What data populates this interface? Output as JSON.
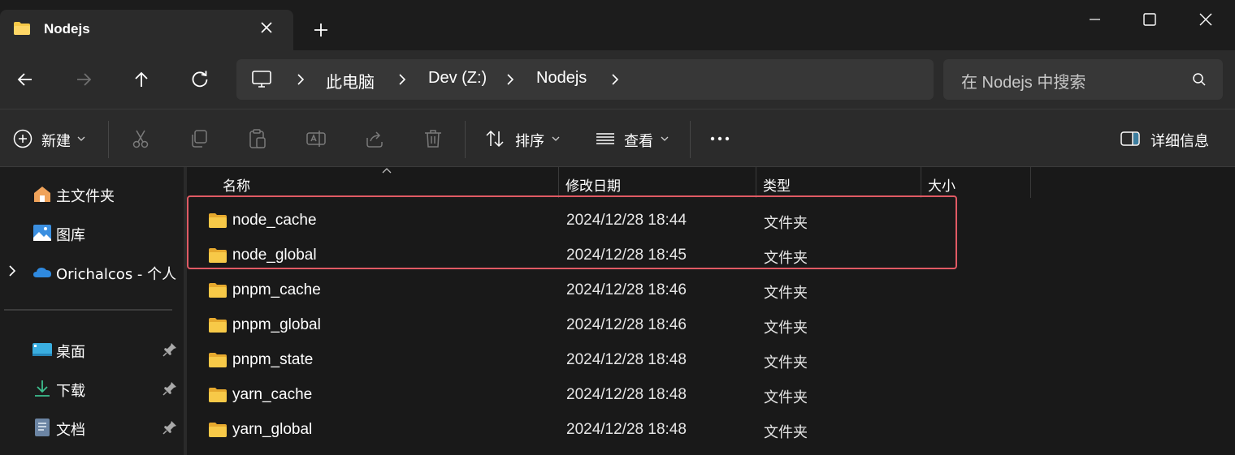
{
  "tab": {
    "title": "Nodejs"
  },
  "address": {
    "crumbs": [
      "此电脑",
      "Dev (Z:)",
      "Nodejs"
    ],
    "search_placeholder": "在 Nodejs 中搜索"
  },
  "toolbar": {
    "new_label": "新建",
    "sort_label": "排序",
    "view_label": "查看",
    "details_label": "详细信息"
  },
  "sidebar": {
    "items": [
      {
        "label": "主文件夹",
        "icon": "home-icon"
      },
      {
        "label": "图库",
        "icon": "gallery-icon"
      },
      {
        "label": "Orichalcos - 个人",
        "icon": "onedrive-icon"
      }
    ],
    "pinned": [
      {
        "label": "桌面",
        "icon": "desktop-icon"
      },
      {
        "label": "下载",
        "icon": "download-icon"
      },
      {
        "label": "文档",
        "icon": "document-icon"
      }
    ]
  },
  "columns": {
    "name": "名称",
    "modified": "修改日期",
    "type": "类型",
    "size": "大小"
  },
  "files": [
    {
      "name": "node_cache",
      "modified": "2024/12/28 18:44",
      "type": "文件夹"
    },
    {
      "name": "node_global",
      "modified": "2024/12/28 18:45",
      "type": "文件夹"
    },
    {
      "name": "pnpm_cache",
      "modified": "2024/12/28 18:46",
      "type": "文件夹"
    },
    {
      "name": "pnpm_global",
      "modified": "2024/12/28 18:46",
      "type": "文件夹"
    },
    {
      "name": "pnpm_state",
      "modified": "2024/12/28 18:48",
      "type": "文件夹"
    },
    {
      "name": "yarn_cache",
      "modified": "2024/12/28 18:48",
      "type": "文件夹"
    },
    {
      "name": "yarn_global",
      "modified": "2024/12/28 18:48",
      "type": "文件夹"
    }
  ],
  "colors": {
    "highlight": "#e05a64",
    "folder": "#f7c948",
    "accent": "#4cc2ff"
  }
}
